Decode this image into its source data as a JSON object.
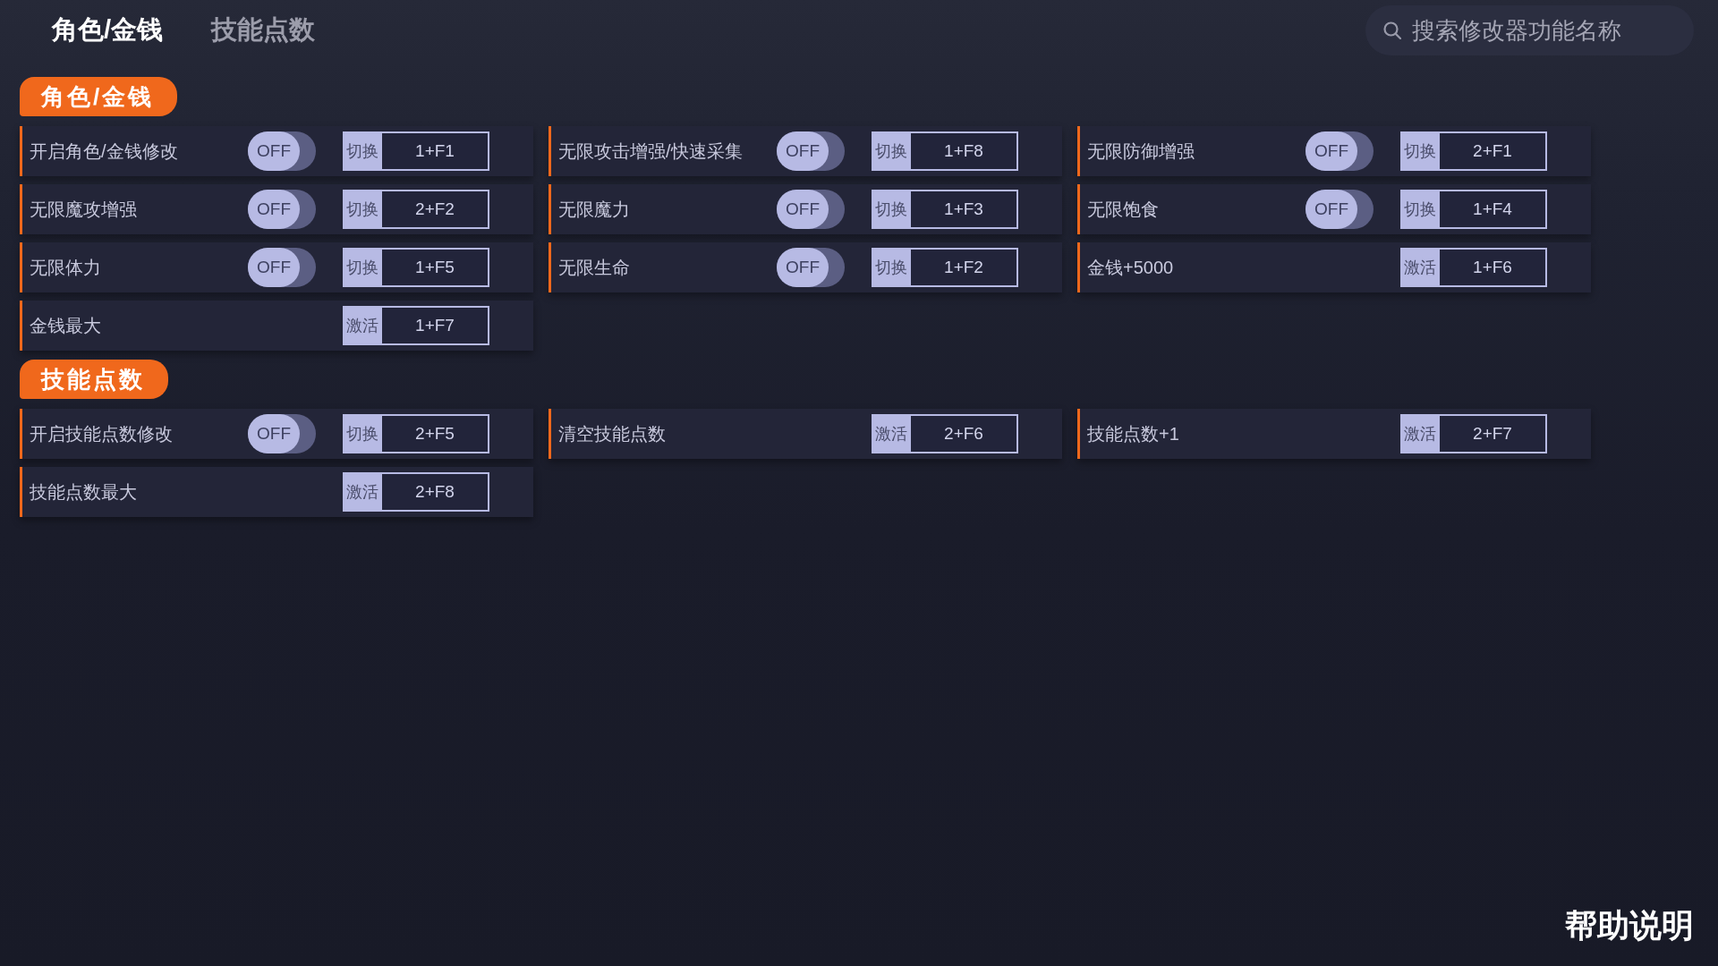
{
  "tabs": [
    {
      "label": "角色/金钱",
      "selected": true
    },
    {
      "label": "技能点数",
      "selected": false
    }
  ],
  "search": {
    "placeholder": "搜索修改器功能名称"
  },
  "sections": [
    {
      "title": "角色/金钱",
      "items": [
        {
          "kind": "toggle",
          "label": "开启角色/金钱修改",
          "on": false,
          "switch_label": "OFF",
          "action": "切换",
          "hotkey": "1+F1"
        },
        {
          "kind": "toggle",
          "label": "无限攻击增强/快速采集",
          "on": false,
          "switch_label": "OFF",
          "action": "切换",
          "hotkey": "1+F8"
        },
        {
          "kind": "toggle",
          "label": "无限防御增强",
          "on": false,
          "switch_label": "OFF",
          "action": "切换",
          "hotkey": "2+F1"
        },
        {
          "kind": "toggle",
          "label": "无限魔攻增强",
          "on": false,
          "switch_label": "OFF",
          "action": "切换",
          "hotkey": "2+F2"
        },
        {
          "kind": "toggle",
          "label": "无限魔力",
          "on": false,
          "switch_label": "OFF",
          "action": "切换",
          "hotkey": "1+F3"
        },
        {
          "kind": "toggle",
          "label": "无限饱食",
          "on": false,
          "switch_label": "OFF",
          "action": "切换",
          "hotkey": "1+F4"
        },
        {
          "kind": "toggle",
          "label": "无限体力",
          "on": false,
          "switch_label": "OFF",
          "action": "切换",
          "hotkey": "1+F5"
        },
        {
          "kind": "toggle",
          "label": "无限生命",
          "on": false,
          "switch_label": "OFF",
          "action": "切换",
          "hotkey": "1+F2"
        },
        {
          "kind": "button",
          "label": "金钱+5000",
          "action": "激活",
          "hotkey": "1+F6"
        },
        {
          "kind": "button",
          "label": "金钱最大",
          "action": "激活",
          "hotkey": "1+F7"
        }
      ]
    },
    {
      "title": "技能点数",
      "items": [
        {
          "kind": "toggle",
          "label": "开启技能点数修改",
          "on": false,
          "switch_label": "OFF",
          "action": "切换",
          "hotkey": "2+F5"
        },
        {
          "kind": "button",
          "label": "清空技能点数",
          "action": "激活",
          "hotkey": "2+F6"
        },
        {
          "kind": "button",
          "label": "技能点数+1",
          "action": "激活",
          "hotkey": "2+F7"
        },
        {
          "kind": "button",
          "label": "技能点数最大",
          "action": "激活",
          "hotkey": "2+F8"
        }
      ]
    }
  ],
  "help_link": "帮助说明"
}
